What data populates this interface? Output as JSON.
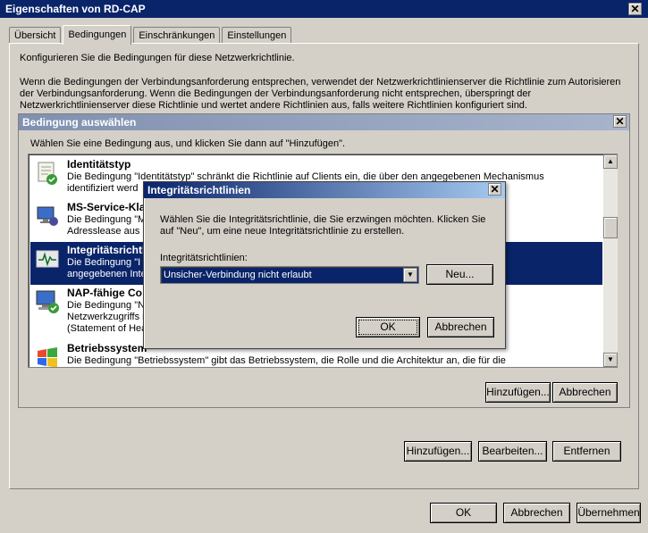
{
  "window": {
    "title": "Eigenschaften von RD-CAP",
    "tabs": [
      "Übersicht",
      "Bedingungen",
      "Einschränkungen",
      "Einstellungen"
    ],
    "active_tab": "Bedingungen"
  },
  "conditions_tab": {
    "intro": "Konfigurieren Sie die Bedingungen für diese Netzwerkrichtlinie.",
    "para": "Wenn die Bedingungen der Verbindungsanforderung entsprechen, verwendet der Netzwerkrichtlinienserver die Richtlinie zum Autorisieren der Verbindungsanforderung. Wenn die Bedingungen der Verbindungsanforderung nicht entsprechen, überspringt der Netzwerkrichtlinienserver diese Richtlinie und wertet andere Richtlinien aus, falls weitere Richtlinien konfiguriert sind.",
    "buttons": {
      "add": "Hinzufügen...",
      "edit": "Bearbeiten...",
      "remove": "Entfernen"
    }
  },
  "select_condition": {
    "title": "Bedingung auswählen",
    "prompt": "Wählen Sie eine Bedingung aus, und klicken Sie dann auf \"Hinzufügen\".",
    "items": [
      {
        "title": "Identitätstyp",
        "desc": "Die Bedingung \"Identitätstyp\" schränkt die Richtlinie auf Clients ein, die über den angegebenen Mechanismus\nidentifiziert werd",
        "icon": "identity-type-icon"
      },
      {
        "title": "MS-Service-Kla",
        "desc": "Die Bedingung \"M                                                                                    eine IP-\nAdresslease aus                                                                                       nt.",
        "icon": "ms-service-class-icon"
      },
      {
        "title": "Integritätsrichtli",
        "desc": "Die Bedingung \"I                                                                                     ätsrichtlinie\nangegebenen Inte",
        "icon": "health-policy-icon"
      },
      {
        "title": "NAP-fähige Co",
        "desc": "Die Bedingung \"N\nNetzwerkzugriffs                                                                                    n SoH\n(Statement of Hea",
        "icon": "nap-computer-icon"
      },
      {
        "title": "Betriebssystem",
        "desc": "Die Bedingung \"Betriebssystem\" gibt das Betriebssystem, die Rolle und die Architektur an, die für die",
        "icon": "os-icon"
      }
    ],
    "buttons": {
      "add": "Hinzufügen...",
      "cancel": "Abbrechen"
    }
  },
  "health_dialog": {
    "title": "Integritätsrichtlinien",
    "prompt": "Wählen Sie die Integritätsrichtlinie, die Sie erzwingen möchten. Klicken Sie auf \"Neu\", um eine neue Integritätsrichtlinie zu erstellen.",
    "label": "Integritätsrichtlinien:",
    "selected": "Unsicher-Verbindung nicht erlaubt",
    "buttons": {
      "new": "Neu...",
      "ok": "OK",
      "cancel": "Abbrechen"
    }
  },
  "footer": {
    "ok": "OK",
    "cancel": "Abbrechen",
    "apply": "Übernehmen"
  }
}
